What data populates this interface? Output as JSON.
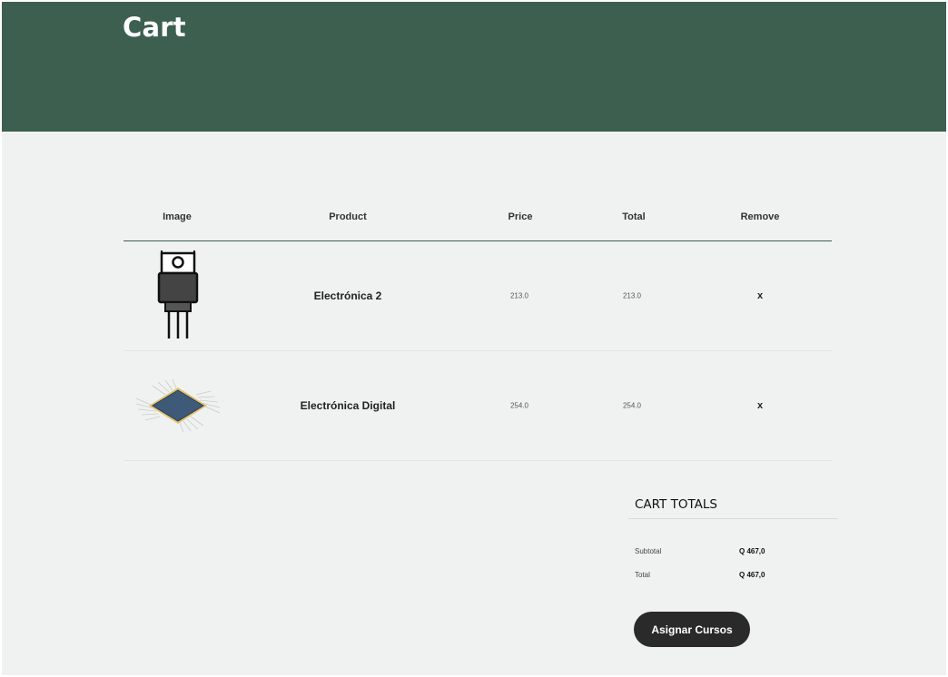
{
  "header": {
    "title": "Cart"
  },
  "table": {
    "columns": [
      "Image",
      "Product",
      "Price",
      "Total",
      "Remove"
    ],
    "rows": [
      {
        "image_icon": "transistor-icon",
        "product": "Electrónica 2",
        "price": "213.0",
        "total": "213.0",
        "remove": "x"
      },
      {
        "image_icon": "microchip-icon",
        "product": "Electrónica Digital",
        "price": "254.0",
        "total": "254.0",
        "remove": "x"
      }
    ]
  },
  "totals": {
    "title": "CART TOTALS",
    "subtotal_label": "Subtotal",
    "subtotal_value": "Q 467,0",
    "total_label": "Total",
    "total_value": "Q 467,0",
    "button_label": "Asignar Cursos"
  },
  "colors": {
    "header_bg": "#3d5f50",
    "page_bg": "#f0f2f1",
    "button_bg": "#2a2a2a"
  }
}
